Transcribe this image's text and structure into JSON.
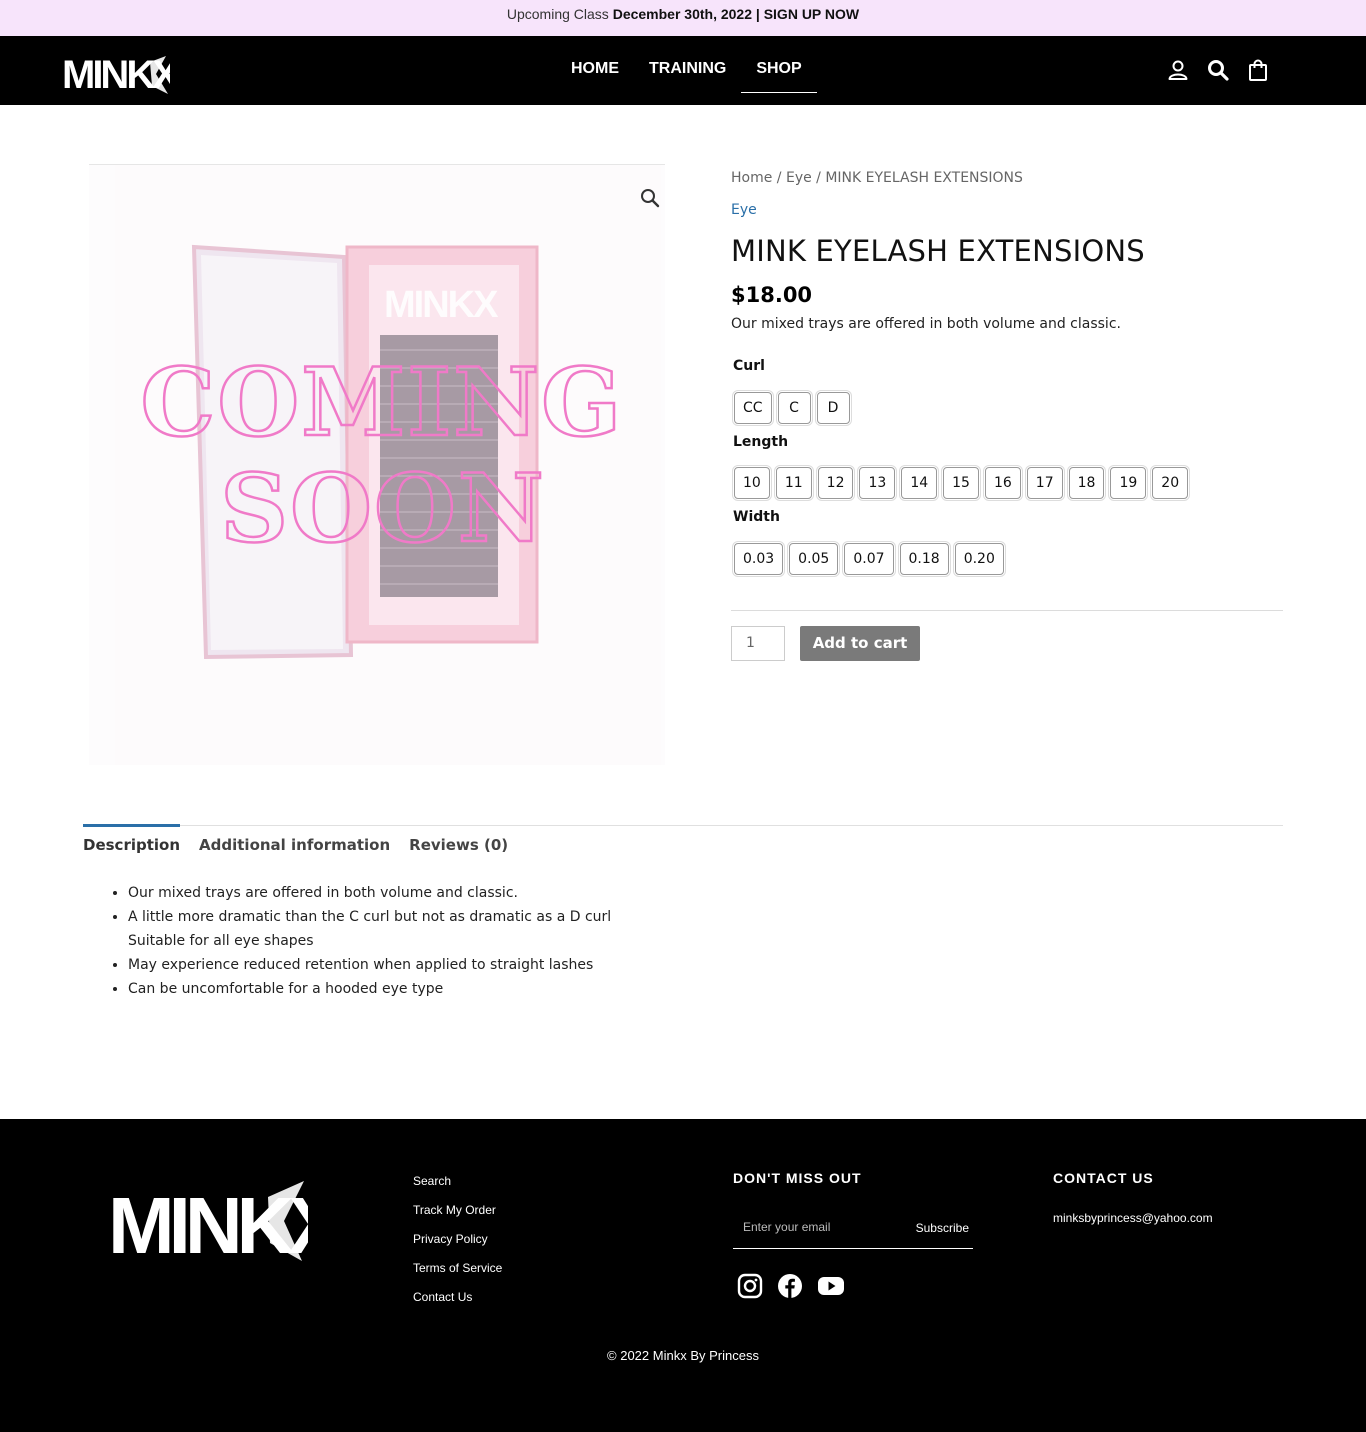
{
  "announcement": {
    "prefix": "Upcoming Class",
    "highlight": "December 30th, 2022 | SIGN UP NOW"
  },
  "header": {
    "logo_text": "MINKX",
    "nav": [
      {
        "label": "HOME"
      },
      {
        "label": "TRAINING"
      },
      {
        "label": "SHOP",
        "active": true
      }
    ],
    "icons": [
      "user-icon",
      "search-icon",
      "shopping-bag-icon"
    ]
  },
  "gallery": {
    "overlay_line1": "COMING",
    "overlay_line2": "SOON",
    "box_logo": "MINKX",
    "zoom_icon": "magnifier-icon"
  },
  "product": {
    "breadcrumb": {
      "home": "Home",
      "sep": " / ",
      "category": "Eye",
      "current": "MINK EYELASH EXTENSIONS"
    },
    "category": "Eye",
    "title": "MINK EYELASH EXTENSIONS",
    "price": "$18.00",
    "short_description": "Our mixed trays are offered in both volume and classic.",
    "attributes": {
      "curl": {
        "label": "Curl",
        "options": [
          "CC",
          "C",
          "D"
        ]
      },
      "length": {
        "label": "Length",
        "options": [
          "10",
          "11",
          "12",
          "13",
          "14",
          "15",
          "16",
          "17",
          "18",
          "19",
          "20"
        ]
      },
      "width": {
        "label": "Width",
        "options": [
          "0.03",
          "0.05",
          "0.07",
          "0.18",
          "0.20"
        ]
      }
    },
    "quantity": "1",
    "add_to_cart": "Add to cart"
  },
  "tabs": {
    "items": [
      {
        "label": "Description",
        "active": true
      },
      {
        "label": "Additional information"
      },
      {
        "label": "Reviews (0)"
      }
    ],
    "description_items": [
      "Our mixed trays are offered in both volume and classic.",
      "A little more dramatic than the C curl but not as dramatic as a D curl Suitable for all eye shapes",
      "May experience reduced retention when applied to straight lashes",
      "Can be uncomfortable for a hooded eye type"
    ]
  },
  "footer": {
    "logo_text": "MINKX",
    "links": [
      "Search",
      "Track My Order",
      "Privacy Policy",
      "Terms of Service",
      "Contact Us"
    ],
    "newsletter": {
      "heading": "DON'T MISS OUT",
      "placeholder": "Enter your email",
      "button": "Subscribe"
    },
    "socials": [
      "instagram-icon",
      "facebook-icon",
      "youtube-icon"
    ],
    "contact": {
      "heading": "CONTACT US",
      "email": "minksbyprincess@yahoo.com"
    },
    "copyright": "© 2022 Minkx By Princess"
  },
  "colors": {
    "announcement_bg": "#f7e4fb",
    "header_bg": "#000000",
    "link_blue": "#2a6fa8",
    "button_gray": "#7a7a7a",
    "coming_soon_pink": "#f07ac8"
  }
}
